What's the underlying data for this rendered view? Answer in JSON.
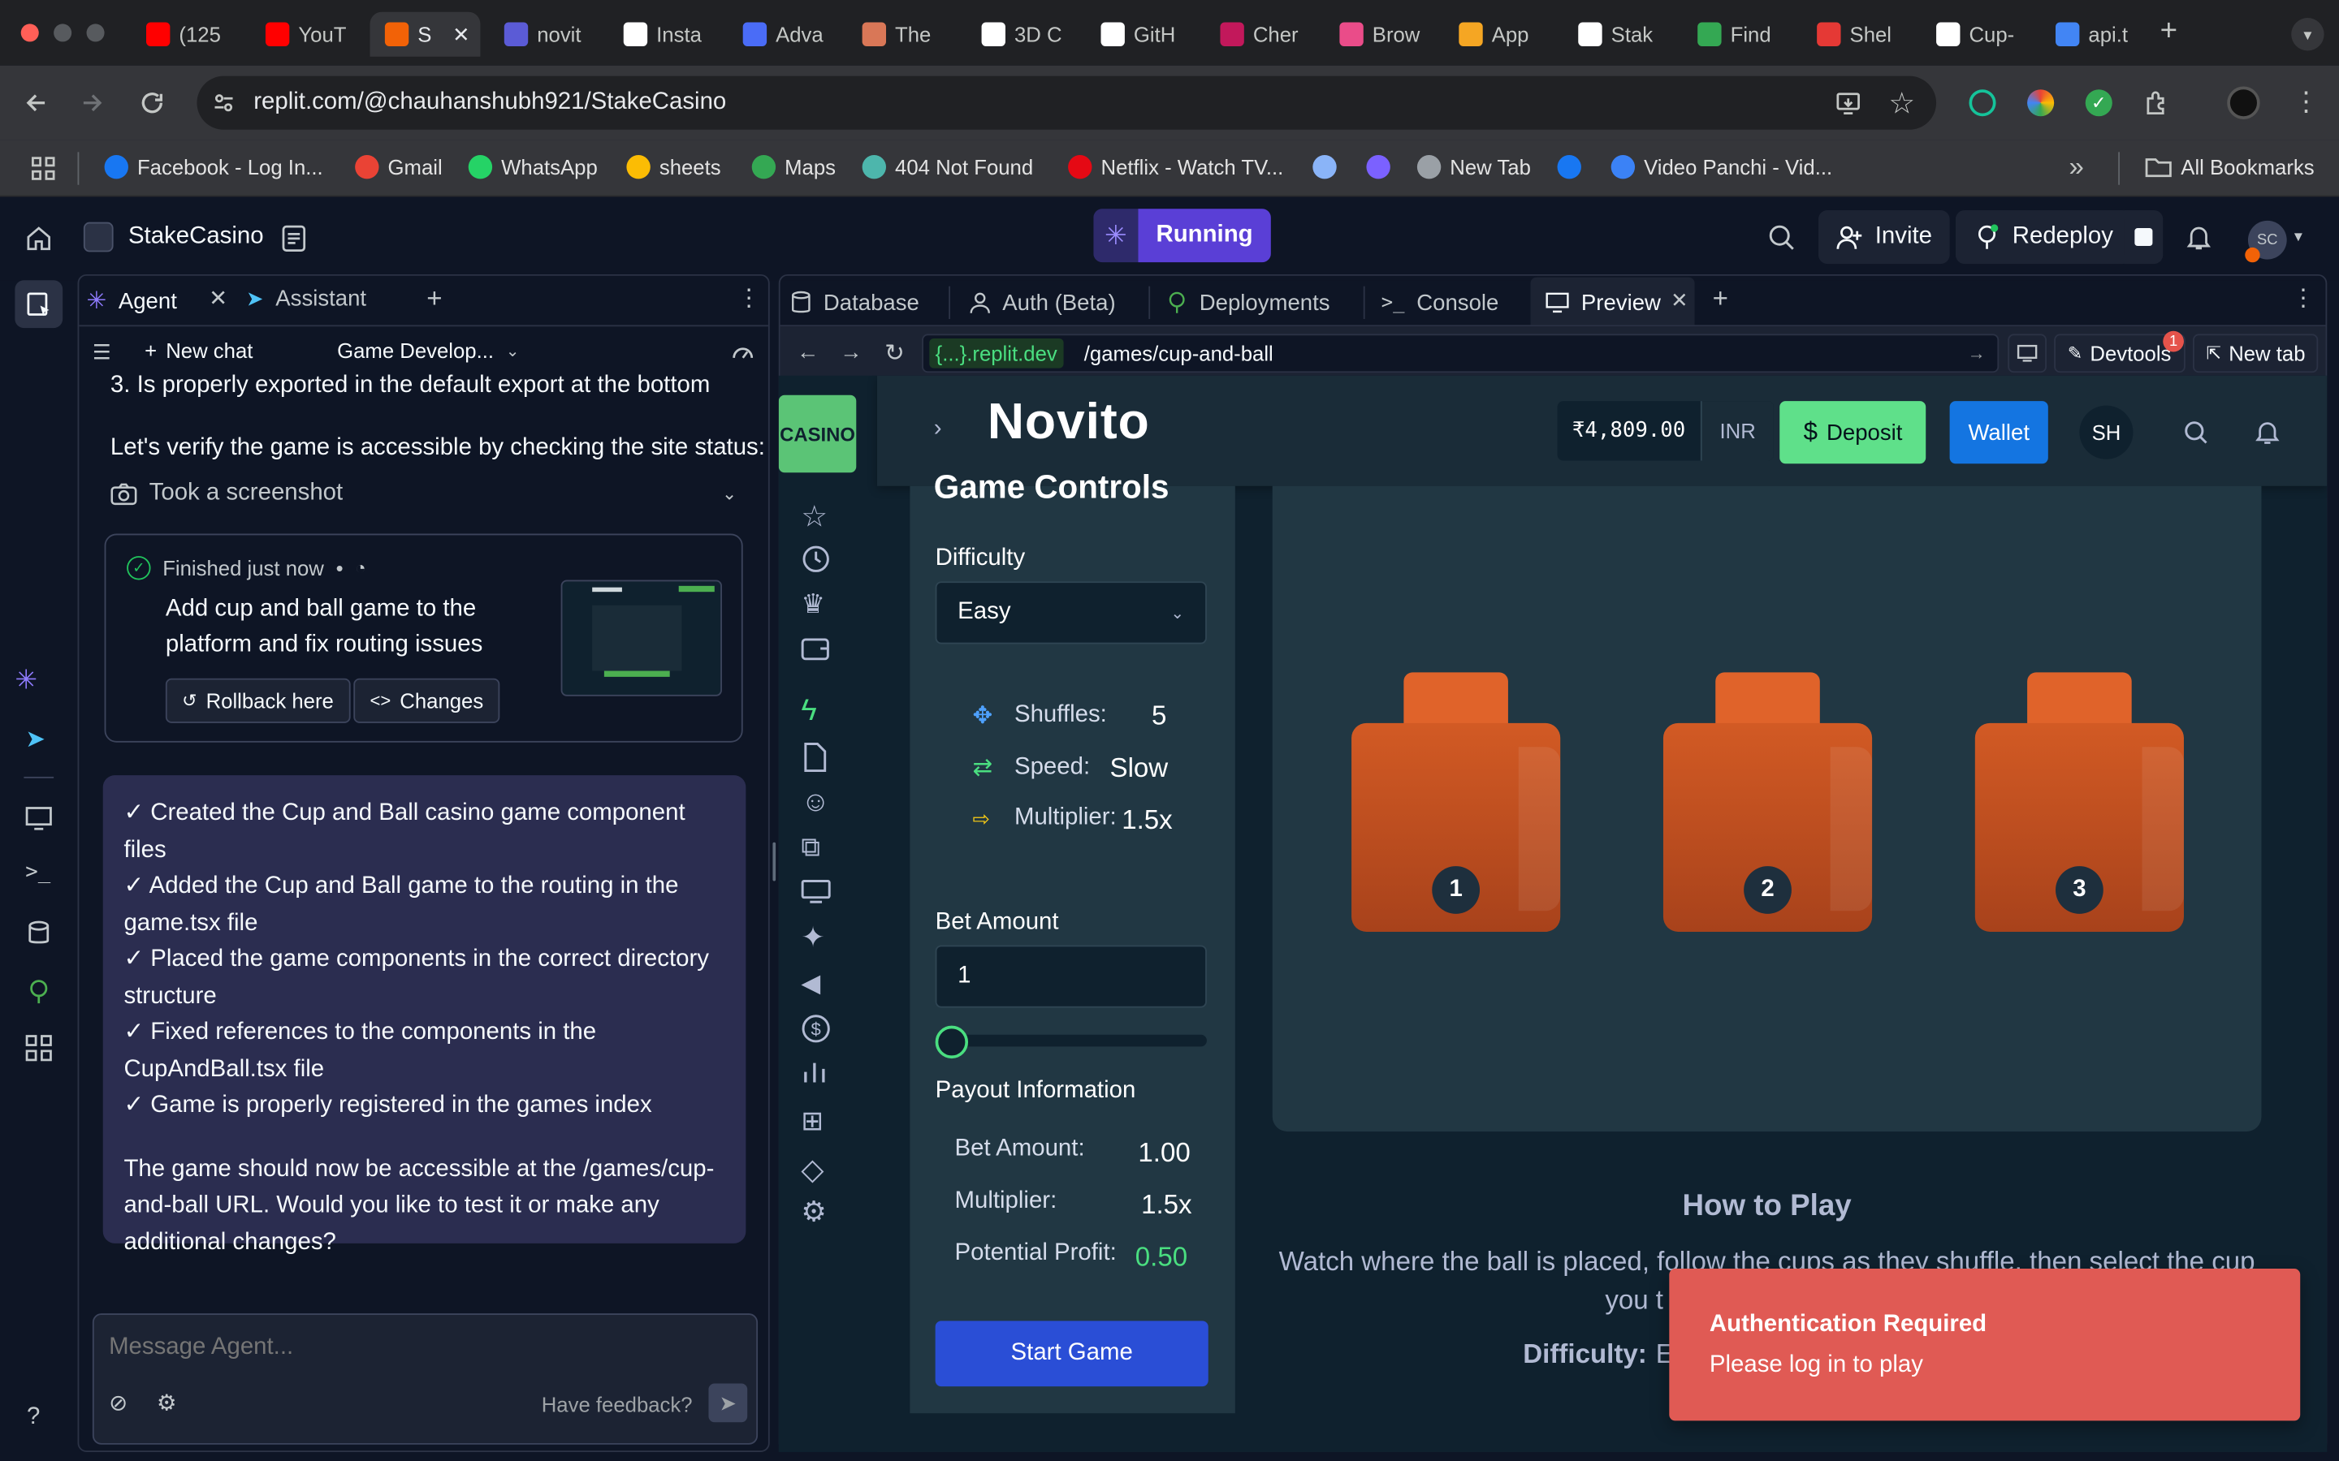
{
  "browser": {
    "tabs": [
      {
        "label": "(125",
        "icon": "youtube",
        "color": "#ff0000"
      },
      {
        "label": "YouT",
        "icon": "youtube-music",
        "color": "#ff0000"
      },
      {
        "label": "S",
        "icon": "replit",
        "color": "#f26207"
      },
      {
        "label": "novit",
        "icon": "novito",
        "color": "#5b5bd6"
      },
      {
        "label": "Insta",
        "icon": "openai",
        "color": "#ffffff"
      },
      {
        "label": "Adva",
        "icon": "generic",
        "color": "#4a6cf7"
      },
      {
        "label": "The",
        "icon": "claude",
        "color": "#d97757"
      },
      {
        "label": "3D C",
        "icon": "openai",
        "color": "#ffffff"
      },
      {
        "label": "GitH",
        "icon": "github",
        "color": "#ffffff"
      },
      {
        "label": "Cher",
        "icon": "generic",
        "color": "#c2185b"
      },
      {
        "label": "Brow",
        "icon": "dribbble",
        "color": "#ea4c89"
      },
      {
        "label": "App",
        "icon": "generic",
        "color": "#f5a623"
      },
      {
        "label": "Stak",
        "icon": "stake",
        "color": "#ffffff"
      },
      {
        "label": "Find",
        "icon": "generic",
        "color": "#34a853"
      },
      {
        "label": "Shel",
        "icon": "generic",
        "color": "#e53935"
      },
      {
        "label": "Cup-",
        "icon": "github",
        "color": "#ffffff"
      },
      {
        "label": "api.t",
        "icon": "generic",
        "color": "#4285f4"
      }
    ],
    "url": "replit.com/@chauhanshubh921/StakeCasino",
    "bookmarks": [
      {
        "label": "Facebook - Log In...",
        "color": "#1877f2"
      },
      {
        "label": "Gmail",
        "color": "#ea4335"
      },
      {
        "label": "WhatsApp",
        "color": "#25d366"
      },
      {
        "label": "sheets",
        "color": "#fbbc04"
      },
      {
        "label": "Maps",
        "color": "#34a853"
      },
      {
        "label": "404 Not Found",
        "color": "#4db6ac"
      },
      {
        "label": "Netflix - Watch TV...",
        "color": "#e50914"
      },
      {
        "label": "",
        "color": "#8ab4f8"
      },
      {
        "label": "",
        "color": "#7b61ff"
      },
      {
        "label": "New Tab",
        "color": "#9aa0a6"
      },
      {
        "label": "",
        "color": "#1877f2"
      },
      {
        "label": "Video Panchi - Vid...",
        "color": "#3b82f6"
      }
    ],
    "all_bookmarks": "All Bookmarks"
  },
  "replit": {
    "project": "StakeCasino",
    "status": "Running",
    "invite": "Invite",
    "redeploy": "Redeploy",
    "avatar": "SC",
    "left_tabs": {
      "agent": "Agent",
      "assistant": "Assistant"
    },
    "chat_toolbar": {
      "new_chat": "New chat",
      "thread": "Game Develop..."
    },
    "messages": {
      "line1": "3. Is properly exported in the default export at the bottom",
      "line2": "Let's verify the game is accessible by checking the site status:",
      "screenshot": "Took a screenshot"
    },
    "checkpoint": {
      "status": "Finished just now",
      "title": "Add cup and ball game to the platform and fix routing issues",
      "rollback": "Rollback here",
      "changes": "Changes"
    },
    "summary": {
      "items": [
        "✓ Created the Cup and Ball casino game component files",
        "✓ Added the Cup and Ball game to the routing in the game.tsx file",
        "✓ Placed the game components in the correct directory structure",
        "✓ Fixed references to the components in the CupAndBall.tsx file",
        "✓ Game is properly registered in the games index"
      ],
      "closing": "The game should now be accessible at the /games/cup-and-ball URL. Would you like to test it or make any additional changes?"
    },
    "composer": {
      "placeholder": "Message Agent...",
      "feedback": "Have feedback?"
    },
    "right_tabs": {
      "database": "Database",
      "auth": "Auth (Beta)",
      "deployments": "Deployments",
      "console": "Console",
      "preview": "Preview"
    },
    "webview": {
      "domain": "{...}.replit.dev",
      "path": "/games/cup-and-ball",
      "devtools": "Devtools",
      "devtools_badge": "1",
      "new_tab": "New tab"
    }
  },
  "app": {
    "casino_label": "CASINO",
    "brand": "Novito",
    "balance": "₹4,809.00",
    "currency": "INR",
    "deposit": "Deposit",
    "wallet": "Wallet",
    "user": "SH",
    "controls": {
      "heading": "Game Controls",
      "difficulty_label": "Difficulty",
      "difficulty_value": "Easy",
      "shuffles_label": "Shuffles:",
      "shuffles_value": "5",
      "speed_label": "Speed:",
      "speed_value": "Slow",
      "multiplier_label": "Multiplier:",
      "multiplier_value": "1.5x",
      "bet_label": "Bet Amount",
      "bet_value": "1",
      "slider_level": 0,
      "payout_heading": "Payout Information",
      "payout_bet_label": "Bet Amount:",
      "payout_bet_value": "1.00",
      "payout_mult_label": "Multiplier:",
      "payout_mult_value": "1.5x",
      "payout_profit_label": "Potential Profit:",
      "payout_profit_value": "0.50",
      "start": "Start Game"
    },
    "cups": [
      "1",
      "2",
      "3"
    ],
    "howto": {
      "title": "How to Play",
      "text": "Watch where the ball is placed, follow the cups as they shuffle, then select the cup",
      "text2": "you t",
      "difficulty_label": "Difficulty:",
      "difficulty_value": "E"
    },
    "toast": {
      "title": "Authentication Required",
      "message": "Please log in to play"
    }
  }
}
